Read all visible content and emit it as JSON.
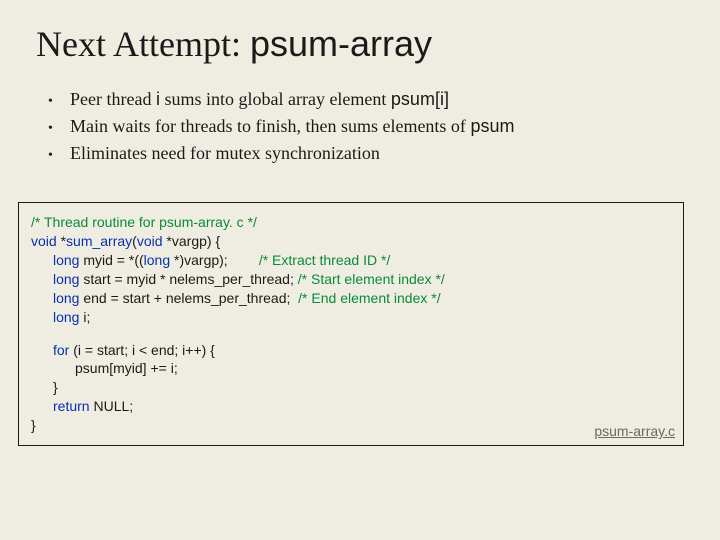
{
  "title": {
    "prefix": "Next Attempt: ",
    "mono": "psum-array"
  },
  "bullets": [
    {
      "pre": "Peer thread ",
      "code1": "i",
      "mid": " sums into global array element ",
      "code2": "psum[i]",
      "post": ""
    },
    {
      "pre": "Main waits for threads to finish, then sums elements of ",
      "code1": "psum",
      "mid": "",
      "code2": "",
      "post": ""
    },
    {
      "pre": "Eliminates need for mutex synchronization",
      "code1": "",
      "mid": "",
      "code2": "",
      "post": ""
    }
  ],
  "code": {
    "comment_header": "/* Thread routine for psum-array. c */",
    "sig_void": "void",
    "sig_star": " *",
    "sig_name": "sum_array",
    "sig_open": "(",
    "sig_argtype": "void",
    "sig_argrest": " *vargp) {",
    "l3_kw": "long",
    "l3_rest": " myid = *((",
    "l3_cast": "long",
    "l3_rest2": " *)vargp);",
    "l3_cmt": "/* Extract thread ID */",
    "l4_kw": "long",
    "l4_rest": " start = myid * nelems_per_thread; ",
    "l4_cmt": "/* Start element index */",
    "l5_kw": "long",
    "l5_rest": " end = start + nelems_per_thread;  ",
    "l5_cmt": "/* End element index */",
    "l6_kw": "long",
    "l6_rest": " i;",
    "for_kw": "for",
    "for_rest": " (i = start; i < end; i++) {",
    "body": "psum[myid] += i;",
    "close_inner": "}",
    "ret_kw": "return",
    "ret_rest": " NULL;",
    "close_outer": "}"
  },
  "chart_data": {
    "type": "table",
    "title": "Thread routine for psum-array.c",
    "code_lines": [
      "/* Thread routine for psum-array. c */",
      "void *sum_array(void *vargp) {",
      "    long myid = *((long *)vargp);        /* Extract thread ID */",
      "    long start = myid * nelems_per_thread; /* Start element index */",
      "    long end = start + nelems_per_thread;  /* End element index */",
      "    long i;",
      "",
      "    for (i = start; i < end; i++) {",
      "        psum[myid] += i;",
      "    }",
      "    return NULL;",
      "}"
    ]
  },
  "filename": "psum-array.c"
}
